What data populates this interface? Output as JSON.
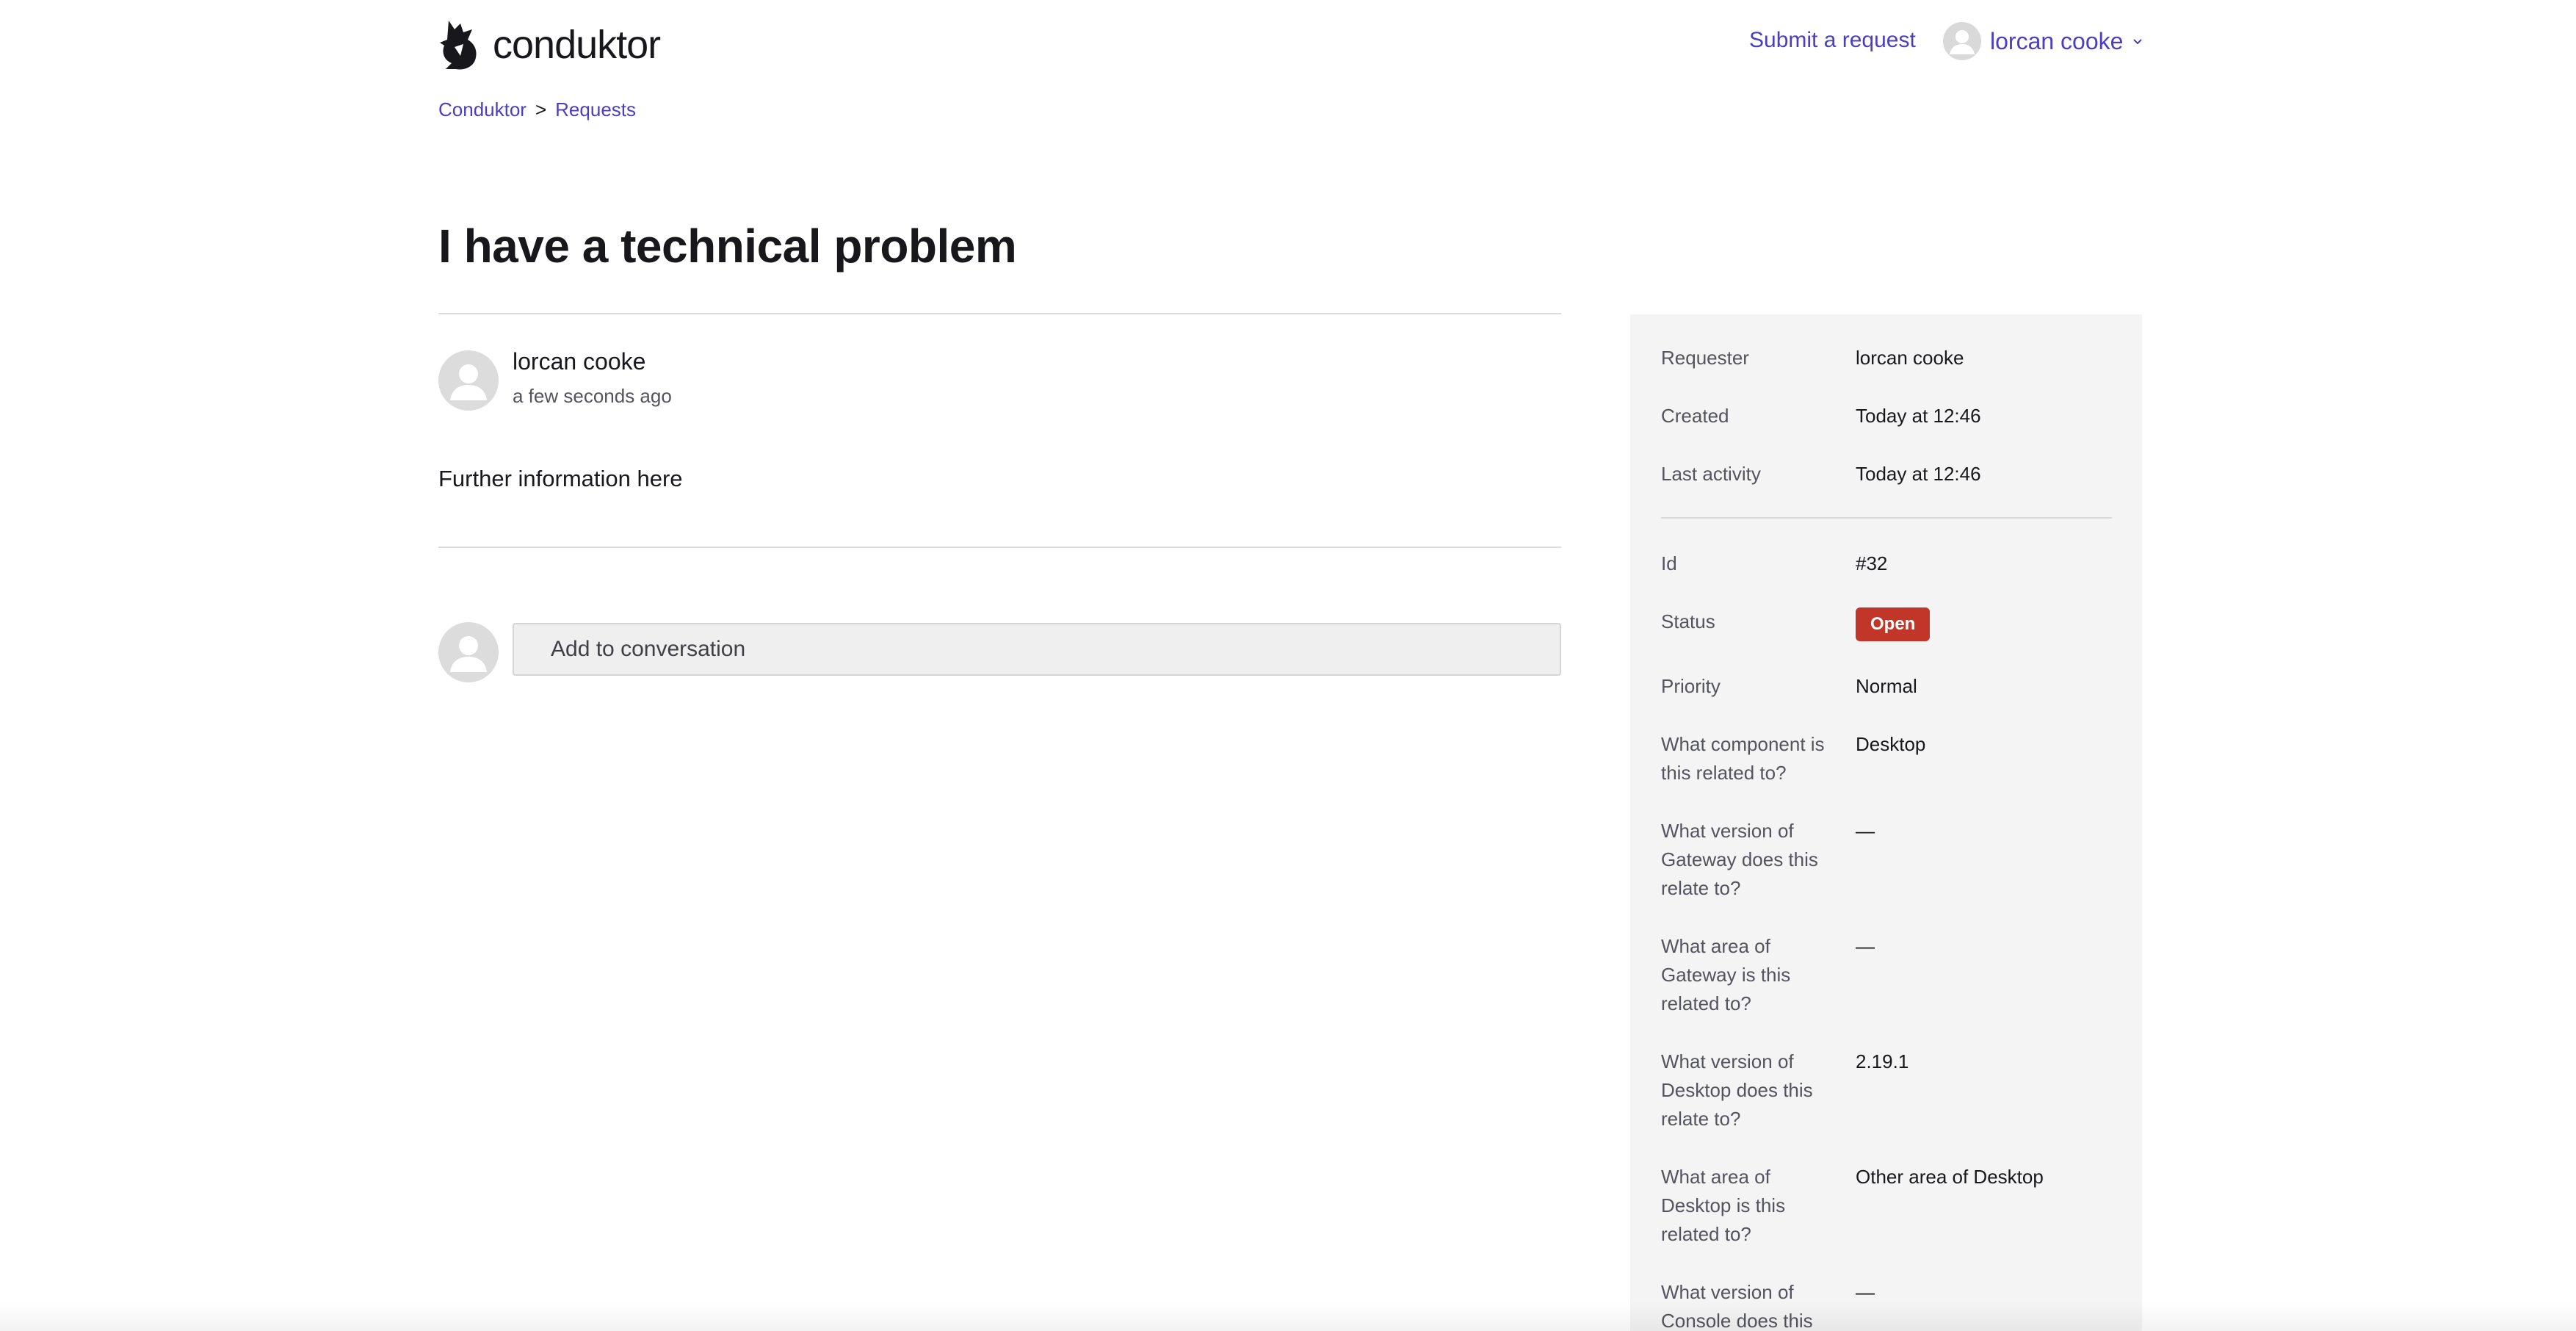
{
  "header": {
    "brand": "conduktor",
    "submit_link": "Submit a request",
    "user_name": "lorcan cooke"
  },
  "breadcrumb": {
    "root": "Conduktor",
    "separator": ">",
    "current": "Requests"
  },
  "request": {
    "title": "I have a technical problem"
  },
  "comment": {
    "author": "lorcan cooke",
    "timestamp": "a few seconds ago",
    "body": "Further information here"
  },
  "reply": {
    "placeholder": "Add to conversation"
  },
  "details": [
    {
      "label": "Requester",
      "value": "lorcan cooke"
    },
    {
      "label": "Created",
      "value": "Today at 12:46"
    },
    {
      "label": "Last activity",
      "value": "Today at 12:46"
    },
    {
      "label": "Id",
      "value": "#32"
    },
    {
      "label": "Status",
      "value": "Open"
    },
    {
      "label": "Priority",
      "value": "Normal"
    },
    {
      "label": "What component is this related to?",
      "value": "Desktop"
    },
    {
      "label": "What version of Gateway does this relate to?",
      "value": "—"
    },
    {
      "label": "What area of Gateway is this related to?",
      "value": "—"
    },
    {
      "label": "What version of Desktop does this relate to?",
      "value": "2.19.1"
    },
    {
      "label": "What area of Desktop is this related to?",
      "value": "Other area of Desktop"
    },
    {
      "label": "What version of Console does this relate to?",
      "value": "—"
    }
  ],
  "colors": {
    "link": "#4b3fc1",
    "status_open": "#c2362a",
    "sidebar_bg": "#f4f4f5"
  }
}
